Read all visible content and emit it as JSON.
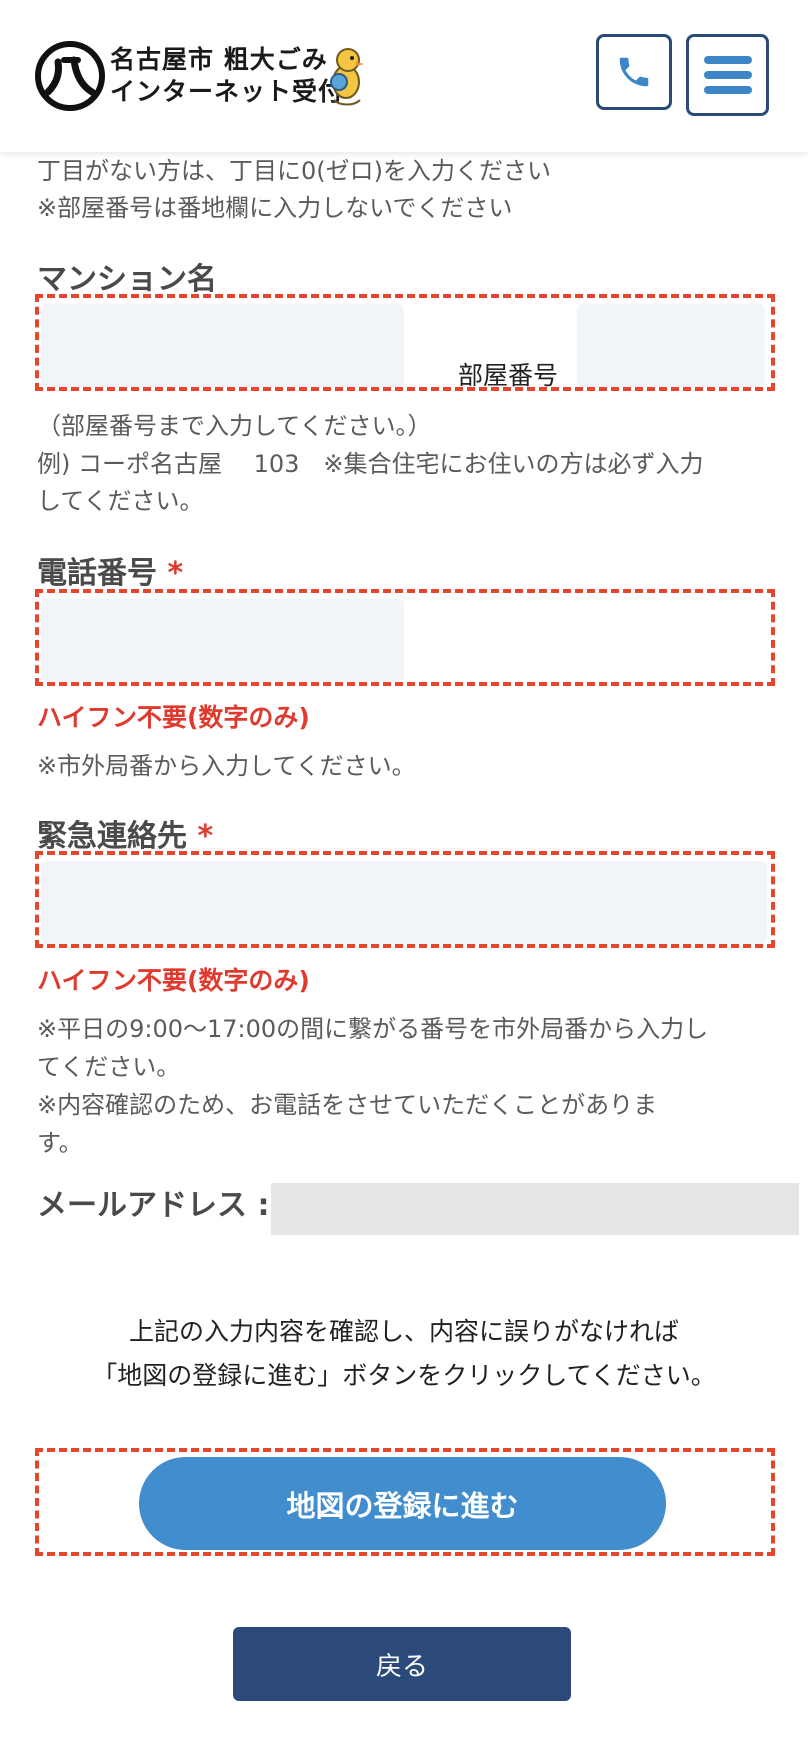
{
  "header": {
    "logo_line1": "名古屋市 粗大ごみ",
    "logo_line2": "インターネット受付"
  },
  "address_notes": {
    "line1": "丁目がない方は、丁目に0(ゼロ)を入力ください",
    "line2": "※部屋番号は番地欄に入力しないでください"
  },
  "mansion": {
    "label": "マンション名",
    "room_label": "部屋番号",
    "note1": "（部屋番号まで入力してください。）",
    "note2": "例) コーポ名古屋　 103　※集合住宅にお住いの方は必ず入力",
    "note3": "してください。"
  },
  "phone": {
    "label": "電話番号",
    "required": "*",
    "error": "ハイフン不要(数字のみ)",
    "note": "※市外局番から入力してください。"
  },
  "emergency": {
    "label": "緊急連絡先",
    "required": "*",
    "error": "ハイフン不要(数字のみ)",
    "note1": "※平日の9:00〜17:00の間に繋がる番号を市外局番から入力し",
    "note2": "てください。",
    "note3": "※内容確認のため、お電話をさせていただくことがありま",
    "note4": "す。"
  },
  "email": {
    "label": "メールアドレス :"
  },
  "confirm": {
    "line1": "上記の入力内容を確認し、内容に誤りがなければ",
    "line2": "「地図の登録に進む」ボタンをクリックしてください。"
  },
  "buttons": {
    "next": "地図の登録に進む",
    "back": "戻る"
  },
  "colors": {
    "accent": "#418dcd",
    "navy": "#2b4a7a",
    "error": "#e03a2e",
    "dashed_border": "#e8452d"
  },
  "icons": {
    "phone": "phone-icon",
    "menu": "hamburger-menu-icon",
    "logo": "nagoya-city-emblem-icon",
    "mascot": "mascot-icon"
  }
}
